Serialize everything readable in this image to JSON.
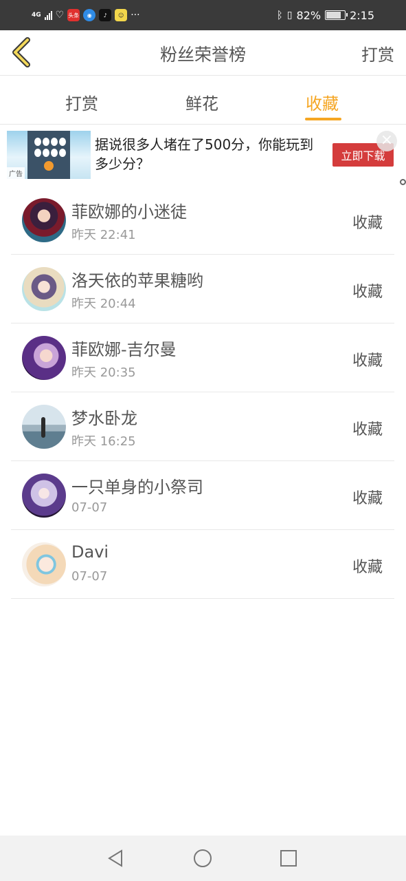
{
  "status_bar": {
    "network": "4G",
    "app_label": "头条",
    "more": "···",
    "battery": "82%",
    "battery_level": 0.82,
    "time": "2:15"
  },
  "header": {
    "title": "粉丝荣誉榜",
    "action_label": "打赏"
  },
  "tabs": [
    {
      "label": "打赏",
      "active": false
    },
    {
      "label": "鲜花",
      "active": false
    },
    {
      "label": "收藏",
      "active": true
    }
  ],
  "ad": {
    "tag": "广告",
    "text": "据说很多人堵在了500分，你能玩到多少分？",
    "button_label": "立即下载",
    "close": "×"
  },
  "colors": {
    "accent": "#f5a623",
    "ad_button": "#d43c3c"
  },
  "fans": [
    {
      "name": "菲欧娜的小迷徒",
      "time": "昨天 22:41",
      "action": "收藏"
    },
    {
      "name": "洛天依的苹果糖哟",
      "time": "昨天 20:44",
      "action": "收藏"
    },
    {
      "name": "菲欧娜-吉尔曼",
      "time": "昨天 20:35",
      "action": "收藏"
    },
    {
      "name": "梦水卧龙",
      "time": "昨天 16:25",
      "action": "收藏"
    },
    {
      "name": "一只单身的小祭司",
      "time": "07-07",
      "action": "收藏"
    },
    {
      "name": "Davi",
      "time": "07-07",
      "action": "收藏"
    }
  ]
}
